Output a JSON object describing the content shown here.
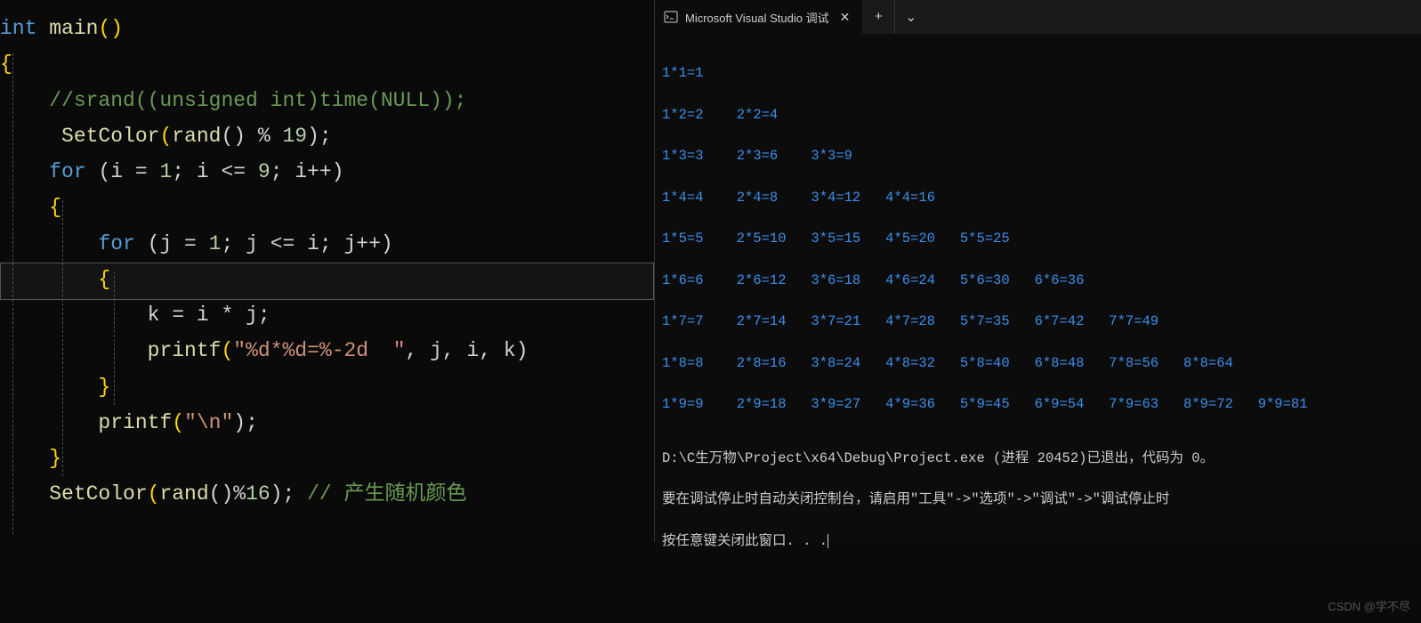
{
  "editor": {
    "line1_kw": "int",
    "line1_fn": " main",
    "line1_p": "()",
    "line2": "{",
    "line3_cmt": "    //srand((unsigned int)time(NULL));",
    "line4_sp": "     ",
    "line4_fn": "SetColor",
    "line4_p1": "(",
    "line4_fn2": "rand",
    "line4_p2": "() % ",
    "line4_n": "19",
    "line4_p3": ");",
    "line5_sp": "    ",
    "line5_kw": "for",
    "line5_p1": " (i = ",
    "line5_n1": "1",
    "line5_p2": "; i <= ",
    "line5_n2": "9",
    "line5_p3": "; i++)",
    "line6": "    {",
    "line7_sp": "        ",
    "line7_kw": "for",
    "line7_p1": " (j = ",
    "line7_n1": "1",
    "line7_p2": "; j <= i; j++)",
    "line8": "        {",
    "line9": "            k = i * j;",
    "line10_sp": "            ",
    "line10_fn": "printf",
    "line10_p1": "(",
    "line10_str": "\"%d*%d=%-2d  \"",
    "line10_p2": ", j, i, k)",
    "line11": "        }",
    "line12_sp": "        ",
    "line12_fn": "printf",
    "line12_p1": "(",
    "line12_str": "\"\\n\"",
    "line12_p2": ");",
    "line13": "    }",
    "line14_sp": "    ",
    "line14_fn": "SetColor",
    "line14_p1": "(",
    "line14_fn2": "rand",
    "line14_p2": "()%",
    "line14_n": "16",
    "line14_p3": "); ",
    "line14_cmt": "// 产生随机颜色"
  },
  "console": {
    "tab_title": "Microsoft Visual Studio 调试",
    "new_tab": "+",
    "dropdown": "⌄",
    "table": [
      "1*1=1",
      "1*2=2    2*2=4",
      "1*3=3    2*3=6    3*3=9",
      "1*4=4    2*4=8    3*4=12   4*4=16",
      "1*5=5    2*5=10   3*5=15   4*5=20   5*5=25",
      "1*6=6    2*6=12   3*6=18   4*6=24   5*6=30   6*6=36",
      "1*7=7    2*7=14   3*7=21   4*7=28   5*7=35   6*7=42   7*7=49",
      "1*8=8    2*8=16   3*8=24   4*8=32   5*8=40   6*8=48   7*8=56   8*8=64",
      "1*9=9    2*9=18   3*9=27   4*9=36   5*9=45   6*9=54   7*9=63   8*9=72   9*9=81"
    ],
    "status1": "D:\\C生万物\\Project\\x64\\Debug\\Project.exe (进程 20452)已退出，代码为 0。",
    "status2": "要在调试停止时自动关闭控制台，请启用\"工具\"->\"选项\"->\"调试\"->\"调试停止时",
    "status3": "按任意键关闭此窗口. . .",
    "watermark": "CSDN @学不尽"
  }
}
